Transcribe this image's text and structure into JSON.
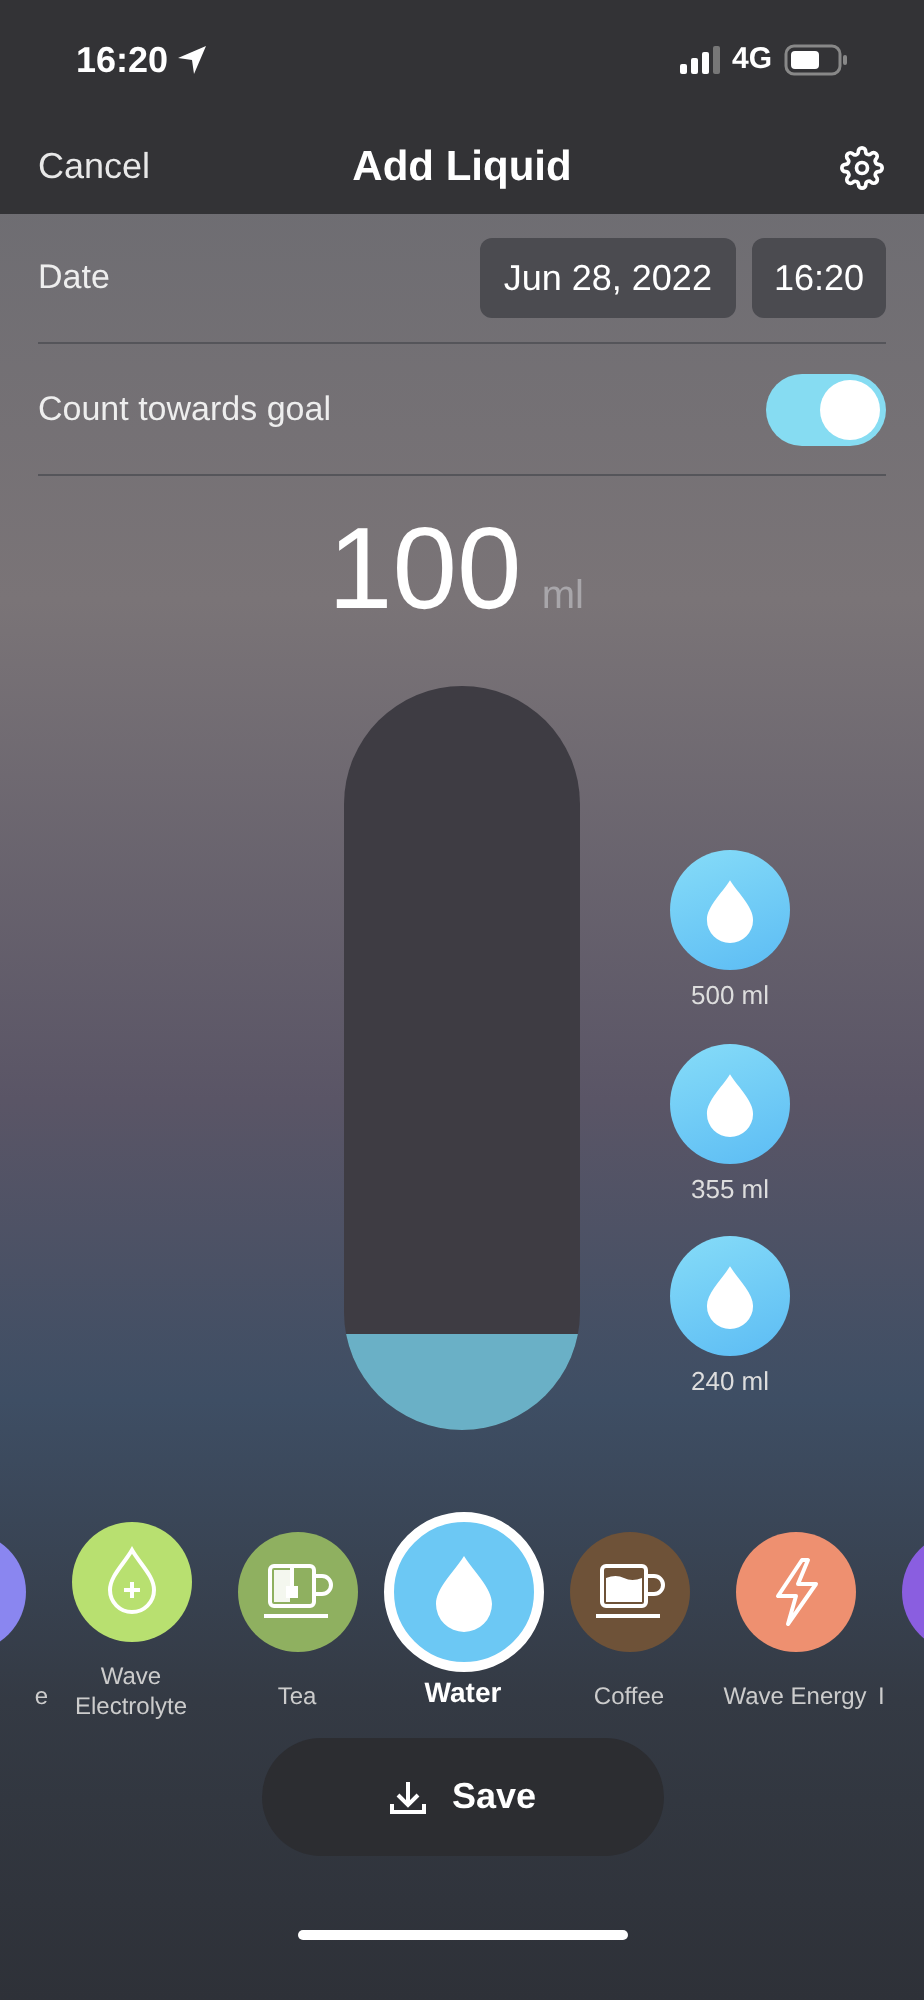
{
  "status_bar": {
    "time": "16:20",
    "network": "4G"
  },
  "nav": {
    "cancel": "Cancel",
    "title": "Add Liquid"
  },
  "date_row": {
    "label": "Date",
    "date": "Jun 28, 2022",
    "time": "16:20"
  },
  "goal_row": {
    "label": "Count towards goal",
    "on": true
  },
  "amount": {
    "value": "100",
    "unit": "ml"
  },
  "bottle": {
    "level": 0.13
  },
  "quick_amounts": [
    {
      "label": "500 ml"
    },
    {
      "label": "355 ml"
    },
    {
      "label": "240 ml"
    }
  ],
  "drinks": [
    {
      "label": "e",
      "kind": "blank",
      "color": "#8a86f0",
      "selected": false
    },
    {
      "label": "Wave Electrolyte",
      "kind": "drop-plus",
      "color": "#b8e070",
      "selected": false
    },
    {
      "label": "Tea",
      "kind": "tea",
      "color": "#8fb060",
      "selected": false
    },
    {
      "label": "Water",
      "kind": "drop",
      "color": "#6cc8f4",
      "selected": true
    },
    {
      "label": "Coffee",
      "kind": "coffee",
      "color": "#6e5238",
      "selected": false
    },
    {
      "label": "Wave Energy",
      "kind": "bolt",
      "color": "#ee9070",
      "selected": false
    },
    {
      "label": "I",
      "kind": "blank",
      "color": "#8a5ee0",
      "selected": false
    }
  ],
  "save": {
    "label": "Save"
  }
}
